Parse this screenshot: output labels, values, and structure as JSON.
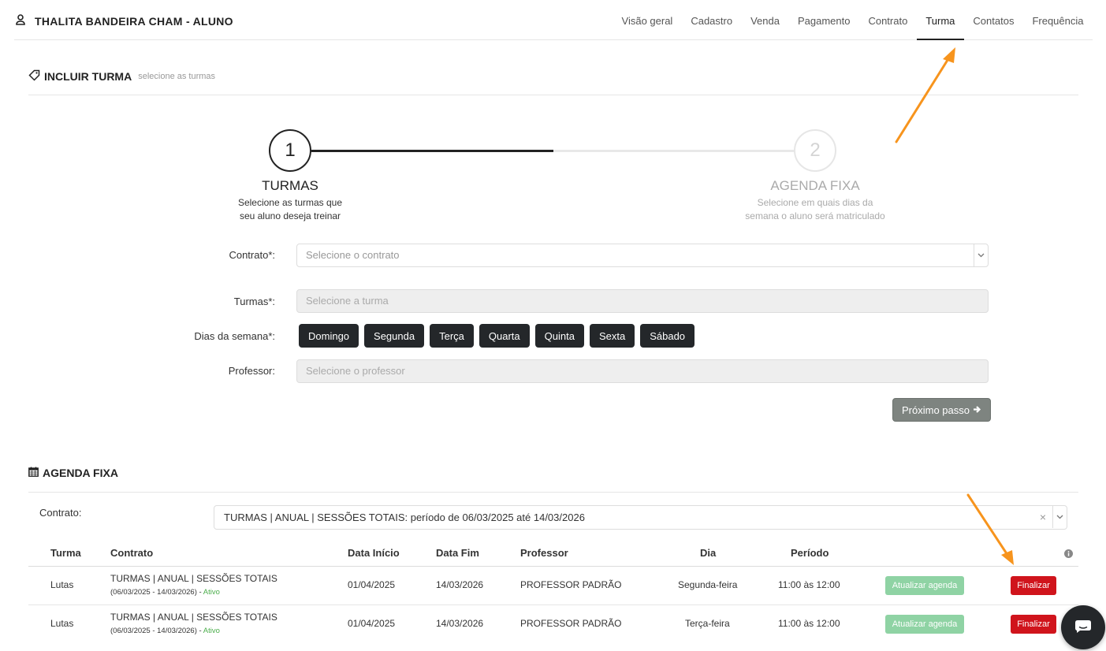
{
  "header": {
    "student_name": "THALITA BANDEIRA CHAM - ALUNO",
    "nav": [
      "Visão geral",
      "Cadastro",
      "Venda",
      "Pagamento",
      "Contrato",
      "Turma",
      "Contatos",
      "Frequência"
    ],
    "active_tab": "Turma"
  },
  "include_section": {
    "title": "INCLUIR TURMA",
    "subtitle": "selecione as turmas"
  },
  "stepper": {
    "steps": [
      {
        "number": "1",
        "title": "TURMAS",
        "desc_line1": "Selecione as turmas que",
        "desc_line2": "seu aluno deseja treinar"
      },
      {
        "number": "2",
        "title": "AGENDA FIXA",
        "desc_line1": "Selecione em quais dias da",
        "desc_line2": "semana o aluno será matriculado"
      }
    ]
  },
  "form": {
    "contrato_label": "Contrato*:",
    "contrato_placeholder": "Selecione o contrato",
    "turmas_label": "Turmas*:",
    "turmas_placeholder": "Selecione a turma",
    "dias_label": "Dias da semana*:",
    "dias": [
      "Domingo",
      "Segunda",
      "Terça",
      "Quarta",
      "Quinta",
      "Sexta",
      "Sábado"
    ],
    "professor_label": "Professor:",
    "professor_placeholder": "Selecione o professor",
    "next_button": "Próximo passo"
  },
  "agenda": {
    "title": "AGENDA FIXA",
    "contract_label": "Contrato:",
    "contract_value": "TURMAS | ANUAL | SESSÕES TOTAIS: período de 06/03/2025 até 14/03/2026",
    "columns": [
      "Turma",
      "Contrato",
      "Data Início",
      "Data Fim",
      "Professor",
      "Dia",
      "Período"
    ],
    "rows": [
      {
        "turma": "Lutas",
        "contrato": "TURMAS | ANUAL | SESSÕES TOTAIS",
        "contrato_periodo": "(06/03/2025 - 14/03/2026) - ",
        "status": "Ativo",
        "data_inicio": "01/04/2025",
        "data_fim": "14/03/2026",
        "professor": "PROFESSOR PADRÃO",
        "dia": "Segunda-feira",
        "periodo": "11:00 às 12:00",
        "update_label": "Atualizar agenda",
        "finish_label": "Finalizar"
      },
      {
        "turma": "Lutas",
        "contrato": "TURMAS | ANUAL | SESSÕES TOTAIS",
        "contrato_periodo": "(06/03/2025 - 14/03/2026) - ",
        "status": "Ativo",
        "data_inicio": "01/04/2025",
        "data_fim": "14/03/2026",
        "professor": "PROFESSOR PADRÃO",
        "dia": "Terça-feira",
        "periodo": "11:00 às 12:00",
        "update_label": "Atualizar agenda",
        "finish_label": "Finalizar"
      }
    ]
  },
  "colors": {
    "dark": "#24272a",
    "annotation_arrow": "#f7941d",
    "update_button": "#8fd3a4",
    "finish_button": "#d0141c",
    "status_active": "#4cae4c"
  }
}
